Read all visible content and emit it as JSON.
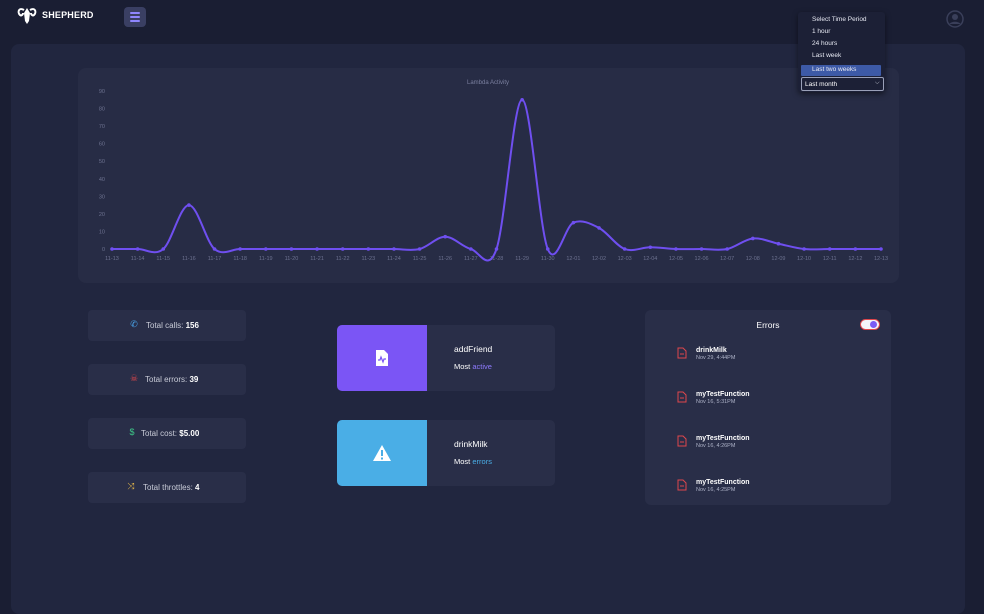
{
  "header": {
    "brand": "SHEPHERD",
    "logo_icon": "ram-logo-icon",
    "menu_icon": "hamburger-menu-icon",
    "avatar_icon": "user-avatar-icon"
  },
  "time_period": {
    "heading": "Select Time Period",
    "options": [
      "1 hour",
      "24 hours",
      "Last week",
      "Last two weeks",
      "Last month"
    ],
    "highlighted": "Last two weeks",
    "selected": "Last month"
  },
  "chart_data": {
    "type": "line",
    "title": "Lambda Activity",
    "xlabel": "",
    "ylabel": "",
    "ylim": [
      0,
      90
    ],
    "y_ticks": [
      0,
      10,
      20,
      30,
      40,
      50,
      60,
      70,
      80,
      90
    ],
    "x": [
      "11-13",
      "11-14",
      "11-15",
      "11-16",
      "11-17",
      "11-18",
      "11-19",
      "11-20",
      "11-21",
      "11-22",
      "11-23",
      "11-24",
      "11-25",
      "11-26",
      "11-27",
      "11-28",
      "11-29",
      "11-30",
      "12-01",
      "12-02",
      "12-03",
      "12-04",
      "12-05",
      "12-06",
      "12-07",
      "12-08",
      "12-09",
      "12-10",
      "12-11",
      "12-12",
      "12-13"
    ],
    "series": [
      {
        "color": "#6f4ff0",
        "values": [
          0,
          0,
          0,
          25,
          0,
          0,
          0,
          0,
          0,
          0,
          0,
          0,
          0,
          7,
          0,
          0,
          85,
          0,
          15,
          12,
          0,
          1,
          0,
          0,
          0,
          6,
          3,
          0,
          0,
          0,
          0
        ]
      }
    ],
    "grid": false
  },
  "stats": [
    {
      "icon": "phone-icon",
      "label": "Total calls:",
      "value": "156",
      "color": "#4aa8f0"
    },
    {
      "icon": "bug-icon",
      "label": "Total errors:",
      "value": "39",
      "color": "#e0474c"
    },
    {
      "icon": "dollar-icon",
      "label": "Total cost:",
      "value": "$5.00",
      "color": "#3ec98a"
    },
    {
      "icon": "shuffle-icon",
      "label": "Total throttles:",
      "value": "4",
      "color": "#e6b84a"
    }
  ],
  "most_active": {
    "name": "addFriend",
    "prefix": "Most",
    "keyword": "active",
    "color": "#7b55f5",
    "keyword_color": "#8f7bff",
    "icon": "activity-file-icon"
  },
  "most_errors": {
    "name": "drinkMilk",
    "prefix": "Most",
    "keyword": "errors",
    "color": "#4aaee6",
    "keyword_color": "#4aaee6",
    "icon": "warning-icon"
  },
  "errors_panel": {
    "title": "Errors",
    "toggle_icon": "toggle-switch-icon",
    "items": [
      {
        "name": "drinkMilk",
        "time": "Nov 29, 4:44PM"
      },
      {
        "name": "myTestFunction",
        "time": "Nov 16, 5:31PM"
      },
      {
        "name": "myTestFunction",
        "time": "Nov 16, 4:26PM"
      },
      {
        "name": "myTestFunction",
        "time": "Nov 16, 4:25PM"
      }
    ]
  }
}
